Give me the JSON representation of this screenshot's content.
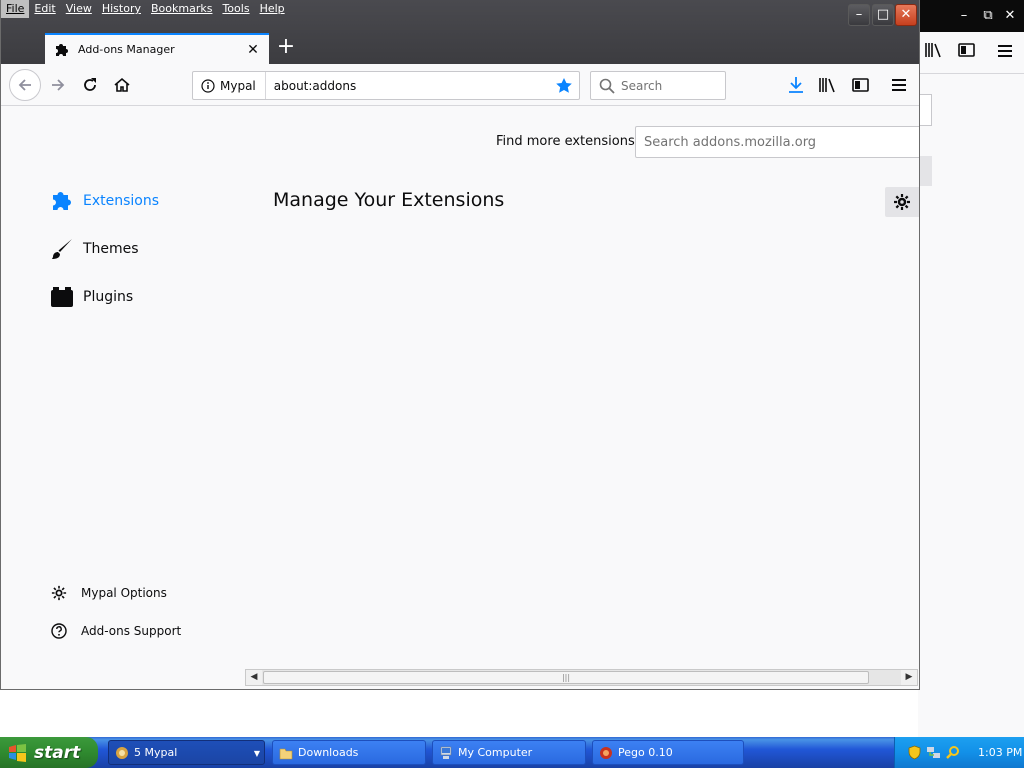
{
  "menubar": {
    "items": [
      "File",
      "Edit",
      "View",
      "History",
      "Bookmarks",
      "Tools",
      "Help"
    ],
    "active": "File"
  },
  "window_controls": {
    "minimize": "–",
    "maximize": "□",
    "close": "✕"
  },
  "tab": {
    "label": "Add-ons Manager",
    "close_symbol": "✕",
    "new_tab_symbol": "+"
  },
  "urlbar": {
    "identity_label": "Mypal",
    "url": "about:addons"
  },
  "searchbar": {
    "placeholder": "Search"
  },
  "content": {
    "find_more_label": "Find more extensions",
    "addon_search_placeholder": "Search addons.mozilla.org",
    "heading": "Manage Your Extensions",
    "categories": [
      {
        "label": "Extensions",
        "icon": "puzzle-piece-icon",
        "selected": true
      },
      {
        "label": "Themes",
        "icon": "paintbrush-icon",
        "selected": false
      },
      {
        "label": "Plugins",
        "icon": "plugin-block-icon",
        "selected": false
      }
    ],
    "footer_links": [
      {
        "label": "Mypal Options",
        "icon": "gear-icon"
      },
      {
        "label": "Add-ons Support",
        "icon": "help-circle-icon"
      }
    ]
  },
  "taskbar": {
    "start_label": "start",
    "buttons": [
      {
        "label": "5 Mypal",
        "icon": "mypal-group-icon",
        "active": true
      },
      {
        "label": "Downloads",
        "icon": "folder-icon",
        "active": false
      },
      {
        "label": "My Computer",
        "icon": "my-computer-icon",
        "active": false
      },
      {
        "label": "Pego 0.10",
        "icon": "pego-icon",
        "active": false
      }
    ],
    "clock": "1:03 PM"
  },
  "colors": {
    "accent": "#0a84ff",
    "taskbar": "#245edb",
    "start_green": "#2f8a2f",
    "close_red": "#c6401e"
  }
}
